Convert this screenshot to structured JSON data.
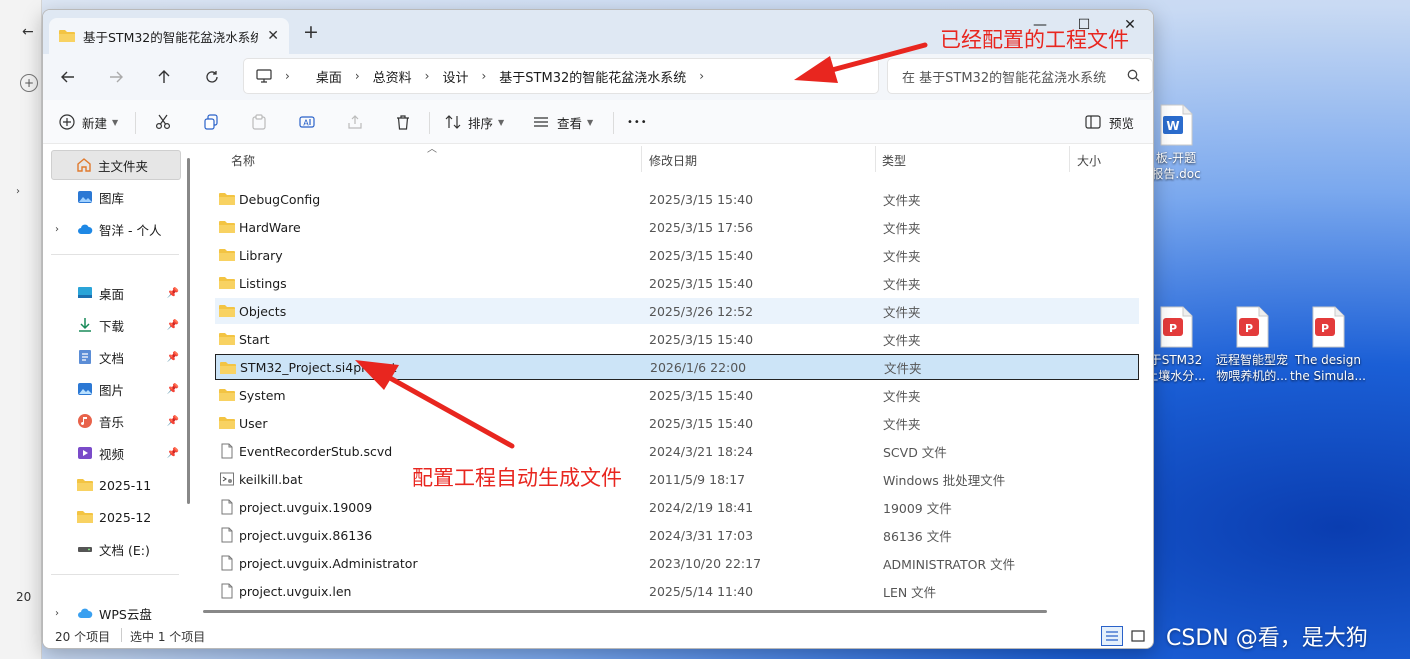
{
  "window": {
    "tab_title": "基于STM32的智能花盆浇水系统",
    "new_tab": "+",
    "close_tab": "✕",
    "minimize": "—",
    "maximize": "☐",
    "close": "✕"
  },
  "breadcrumb": [
    "桌面",
    "总资料",
    "设计",
    "基于STM32的智能花盆浇水系统"
  ],
  "search": {
    "placeholder": "在 基于STM32的智能花盆浇水系统 中搜索"
  },
  "toolbar": {
    "new_label": "新建",
    "sort_label": "排序",
    "view_label": "查看",
    "more_label": "•••",
    "preview_label": "预览"
  },
  "sidebar": {
    "home": "主文件夹",
    "gallery": "图库",
    "onedrive": "智洋 - 个人",
    "desktop": "桌面",
    "downloads": "下载",
    "documents": "文档",
    "pictures": "图片",
    "music": "音乐",
    "videos": "视频",
    "folder1": "2025-11",
    "folder2": "2025-12",
    "drive_e": "文档 (E:)",
    "wps": "WPS云盘"
  },
  "columns": {
    "name": "名称",
    "date": "修改日期",
    "type": "类型",
    "size": "大小"
  },
  "files": [
    {
      "name": "DebugConfig",
      "date": "2025/3/15 15:40",
      "type": "文件夹",
      "icon": "folder-icon"
    },
    {
      "name": "HardWare",
      "date": "2025/3/15 17:56",
      "type": "文件夹",
      "icon": "folder-icon"
    },
    {
      "name": "Library",
      "date": "2025/3/15 15:40",
      "type": "文件夹",
      "icon": "folder-icon"
    },
    {
      "name": "Listings",
      "date": "2025/3/15 15:40",
      "type": "文件夹",
      "icon": "folder-icon"
    },
    {
      "name": "Objects",
      "date": "2025/3/26 12:52",
      "type": "文件夹",
      "icon": "folder-icon"
    },
    {
      "name": "Start",
      "date": "2025/3/15 15:40",
      "type": "文件夹",
      "icon": "folder-icon"
    },
    {
      "name": "STM32_Project.si4project",
      "date": "2026/1/6 22:00",
      "type": "文件夹",
      "icon": "folder-icon"
    },
    {
      "name": "System",
      "date": "2025/3/15 15:40",
      "type": "文件夹",
      "icon": "folder-icon"
    },
    {
      "name": "User",
      "date": "2025/3/15 15:40",
      "type": "文件夹",
      "icon": "folder-icon"
    },
    {
      "name": "EventRecorderStub.scvd",
      "date": "2024/3/21 18:24",
      "type": "SCVD 文件",
      "icon": "file-icon"
    },
    {
      "name": "keilkill.bat",
      "date": "2011/5/9 18:17",
      "type": "Windows 批处理文件",
      "icon": "batch-file-icon"
    },
    {
      "name": "project.uvguix.19009",
      "date": "2024/2/19 18:41",
      "type": "19009 文件",
      "icon": "file-icon"
    },
    {
      "name": "project.uvguix.86136",
      "date": "2024/3/31 17:03",
      "type": "86136 文件",
      "icon": "file-icon"
    },
    {
      "name": "project.uvguix.Administrator",
      "date": "2023/10/20 22:17",
      "type": "ADMINISTRATOR 文件",
      "icon": "file-icon"
    },
    {
      "name": "project.uvguix.len",
      "date": "2025/5/14 11:40",
      "type": "LEN 文件",
      "icon": "file-icon"
    }
  ],
  "status": {
    "count": "20 个项目",
    "selected": "选中 1 个项目"
  },
  "desktop_icons": [
    {
      "line1": "板-开题",
      "line2": "报告.doc"
    },
    {
      "line1": "于STM32",
      "line2": "土壤水分..."
    },
    {
      "line1": "远程智能型宠",
      "line2": "物喂养机的..."
    },
    {
      "line1": "The design",
      "line2": "the Simula..."
    }
  ],
  "background_window": {
    "left_status": "20"
  },
  "annotations": {
    "top": "已经配置的工程文件",
    "middle": "配置工程自动生成文件"
  },
  "watermark": "CSDN @看，是大狗",
  "colors": {
    "annotation": "#e8261f",
    "selection": "#cce4f7",
    "folder": "#f3c443"
  }
}
